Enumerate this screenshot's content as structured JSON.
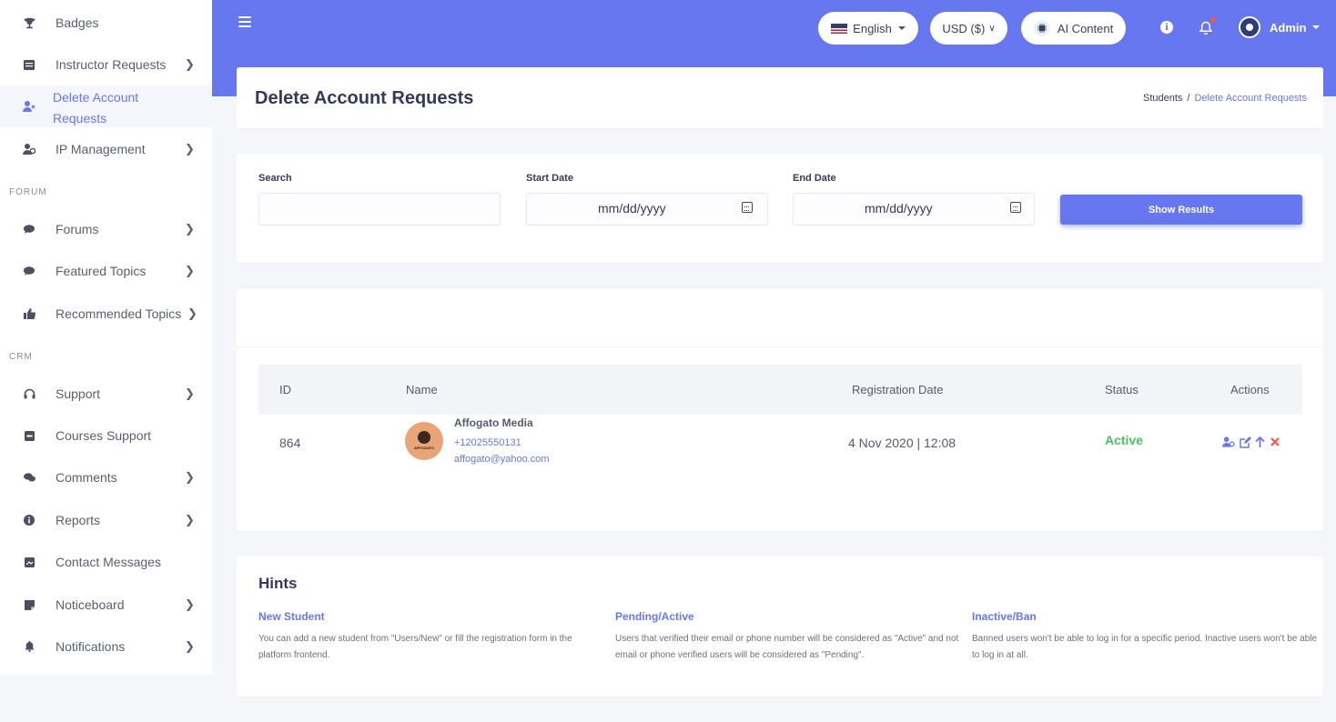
{
  "sidebar": {
    "items": [
      {
        "label": "Badges",
        "icon": "trophy-icon"
      },
      {
        "label": "Instructor Requests",
        "icon": "list-icon"
      },
      {
        "label": "Delete Account",
        "label2": "Requests",
        "icon": "user-delete-icon"
      },
      {
        "label": "IP Management",
        "icon": "users-icon"
      },
      {
        "label": "Forums",
        "icon": "chat-icon"
      },
      {
        "label": "Featured Topics",
        "icon": "chat-bubble-icon"
      },
      {
        "label": "Recommended Topics",
        "icon": "thumbs-up-icon"
      },
      {
        "label": "Support",
        "icon": "headphones-icon"
      },
      {
        "label": "Courses Support",
        "icon": "inbox-icon"
      },
      {
        "label": "Comments",
        "icon": "comments-icon"
      },
      {
        "label": "Reports",
        "icon": "info-circle-icon"
      },
      {
        "label": "Contact Messages",
        "icon": "message-box-icon"
      },
      {
        "label": "Noticeboard",
        "icon": "sticky-note-icon"
      },
      {
        "label": "Notifications",
        "icon": "bell-icon"
      }
    ],
    "sections": {
      "forum": "FORUM",
      "crm": "CRM"
    }
  },
  "header": {
    "language": "English",
    "currency": "USD ($)",
    "ai_content": "AI Content",
    "user": "Admin"
  },
  "page": {
    "title": "Delete Account Requests",
    "breadcrumb": {
      "parent": "Students",
      "sep": "/",
      "current": "Delete Account Requests"
    }
  },
  "filters": {
    "search_label": "Search",
    "search_value": "",
    "start_label": "Start Date",
    "start_placeholder": "mm/dd/yyyy",
    "end_label": "End Date",
    "end_placeholder": "mm/dd/yyyy",
    "submit": "Show Results"
  },
  "table": {
    "headers": {
      "id": "ID",
      "name": "Name",
      "date": "Registration Date",
      "status": "Status",
      "actions": "Actions"
    },
    "rows": [
      {
        "id": "864",
        "name": "Affogato Media",
        "avatar_text": "AFFOGATO",
        "phone": "+12025550131",
        "email": "affogato@yahoo.com",
        "date": "4 Nov 2020 | 12:08",
        "status": "Active"
      }
    ]
  },
  "hints": {
    "title": "Hints",
    "items": [
      {
        "title": "New Student",
        "text": "You can add a new student from \"Users/New\" or fill the registration form in the platform frontend."
      },
      {
        "title": "Pending/Active",
        "text": "Users that verified their email or phone number will be considered as \"Active\" and not email or phone verified users will be considered as \"Pending\"."
      },
      {
        "title": "Inactive/Ban",
        "text": "Banned users won't be able to log in for a specific period. Inactive users won't be able to log in at all."
      }
    ]
  },
  "colors": {
    "primary": "#6777ef",
    "success": "#47c363",
    "danger": "#fc544b"
  }
}
